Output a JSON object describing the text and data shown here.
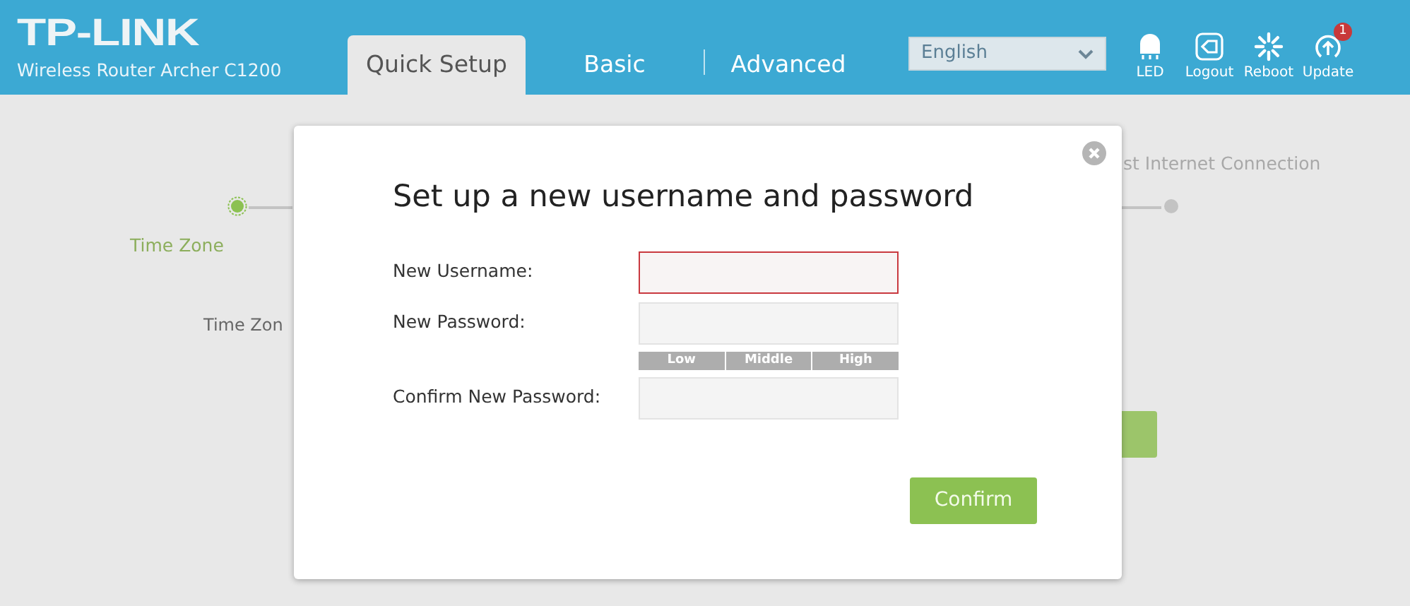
{
  "header": {
    "logo": "TP-LINK",
    "model": "Wireless Router Archer C1200",
    "tabs": [
      {
        "label": "Quick Setup",
        "selected": true
      },
      {
        "label": "Basic",
        "selected": false
      },
      {
        "label": "Advanced",
        "selected": false
      }
    ],
    "language": "English",
    "tools": [
      {
        "kind": "led",
        "label": "LED"
      },
      {
        "kind": "logout",
        "label": "Logout"
      },
      {
        "kind": "reboot",
        "label": "Reboot"
      },
      {
        "kind": "update",
        "label": "Update",
        "badge": "1"
      }
    ]
  },
  "wizard": {
    "steps": [
      {
        "label": "Time Zone",
        "selected": true
      },
      {
        "label": "st Internet Connection",
        "selected": false
      }
    ],
    "section_label": "Time Zon"
  },
  "dialog": {
    "title": "Set up a new username and password",
    "fields": [
      {
        "label": "New Username:",
        "invalid": true
      },
      {
        "label": "New Password:",
        "invalid": false,
        "strength_levels": [
          "Low",
          "Middle",
          "High"
        ]
      },
      {
        "label": "Confirm New Password:",
        "invalid": false
      }
    ],
    "button": "Confirm"
  }
}
